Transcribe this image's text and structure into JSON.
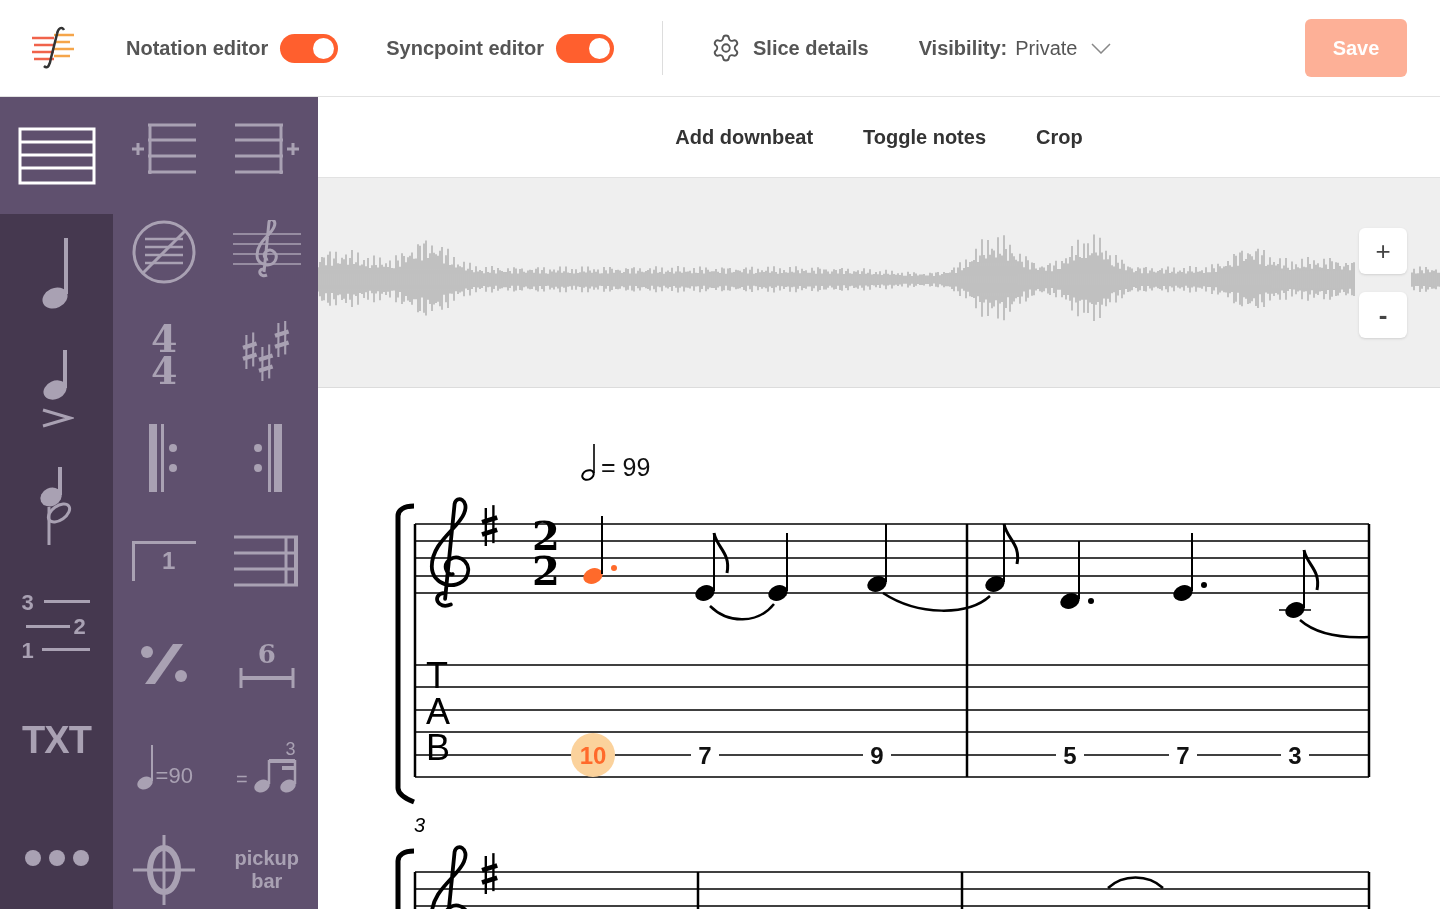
{
  "header": {
    "toggles": [
      {
        "label": "Notation editor",
        "on": true
      },
      {
        "label": "Syncpoint editor",
        "on": true
      }
    ],
    "slice_details": "Slice details",
    "visibility": {
      "label": "Visibility:",
      "value": "Private"
    },
    "save": {
      "label": "Save",
      "disabled": true
    }
  },
  "palette": {
    "categories": [
      {
        "kind": "staff",
        "selected": true
      },
      {
        "kind": "note",
        "selected": false
      },
      {
        "kind": "articulation",
        "selected": false
      },
      {
        "kind": "grace",
        "selected": false
      },
      {
        "kind": "strings",
        "labels": [
          "3",
          "2",
          "1"
        ],
        "selected": false
      },
      {
        "kind": "text",
        "label": "TXT",
        "selected": false
      },
      {
        "kind": "more",
        "selected": false
      }
    ],
    "tools": [
      {
        "kind": "bar-before"
      },
      {
        "kind": "bar-after"
      },
      {
        "kind": "no-staff"
      },
      {
        "kind": "clef"
      },
      {
        "kind": "time",
        "labels": [
          "4",
          "4"
        ]
      },
      {
        "kind": "key"
      },
      {
        "kind": "repeat-start"
      },
      {
        "kind": "repeat-end"
      },
      {
        "kind": "volta",
        "label": "1"
      },
      {
        "kind": "final-bar"
      },
      {
        "kind": "simile"
      },
      {
        "kind": "tuplet",
        "label": "6"
      },
      {
        "kind": "tempo",
        "label": "=90"
      },
      {
        "kind": "swing",
        "labels": [
          "=",
          "3"
        ]
      },
      {
        "kind": "coda"
      },
      {
        "kind": "pickup",
        "label": "pickup bar"
      }
    ]
  },
  "toolbar": {
    "actions": [
      "Add downbeat",
      "Toggle notes",
      "Crop"
    ]
  },
  "waveform": {
    "zoom_in": "+",
    "zoom_out": "-"
  },
  "score": {
    "tempo": "= 99",
    "time_signature": [
      "2",
      "2"
    ],
    "tab_letters": [
      "T",
      "A",
      "B"
    ],
    "notes": [
      {
        "selected": true
      },
      {
        "selected": false
      },
      {
        "selected": false
      },
      {
        "selected": false
      },
      {
        "selected": false
      },
      {
        "selected": false
      },
      {
        "selected": false
      },
      {
        "selected": false
      }
    ],
    "tab_numbers": [
      {
        "text": "10",
        "selected": true
      },
      {
        "text": "7",
        "selected": false
      },
      {
        "text": "9",
        "selected": false
      },
      {
        "text": "5",
        "selected": false
      },
      {
        "text": "7",
        "selected": false
      },
      {
        "text": "3",
        "selected": false
      }
    ],
    "measure_number": "3"
  }
}
